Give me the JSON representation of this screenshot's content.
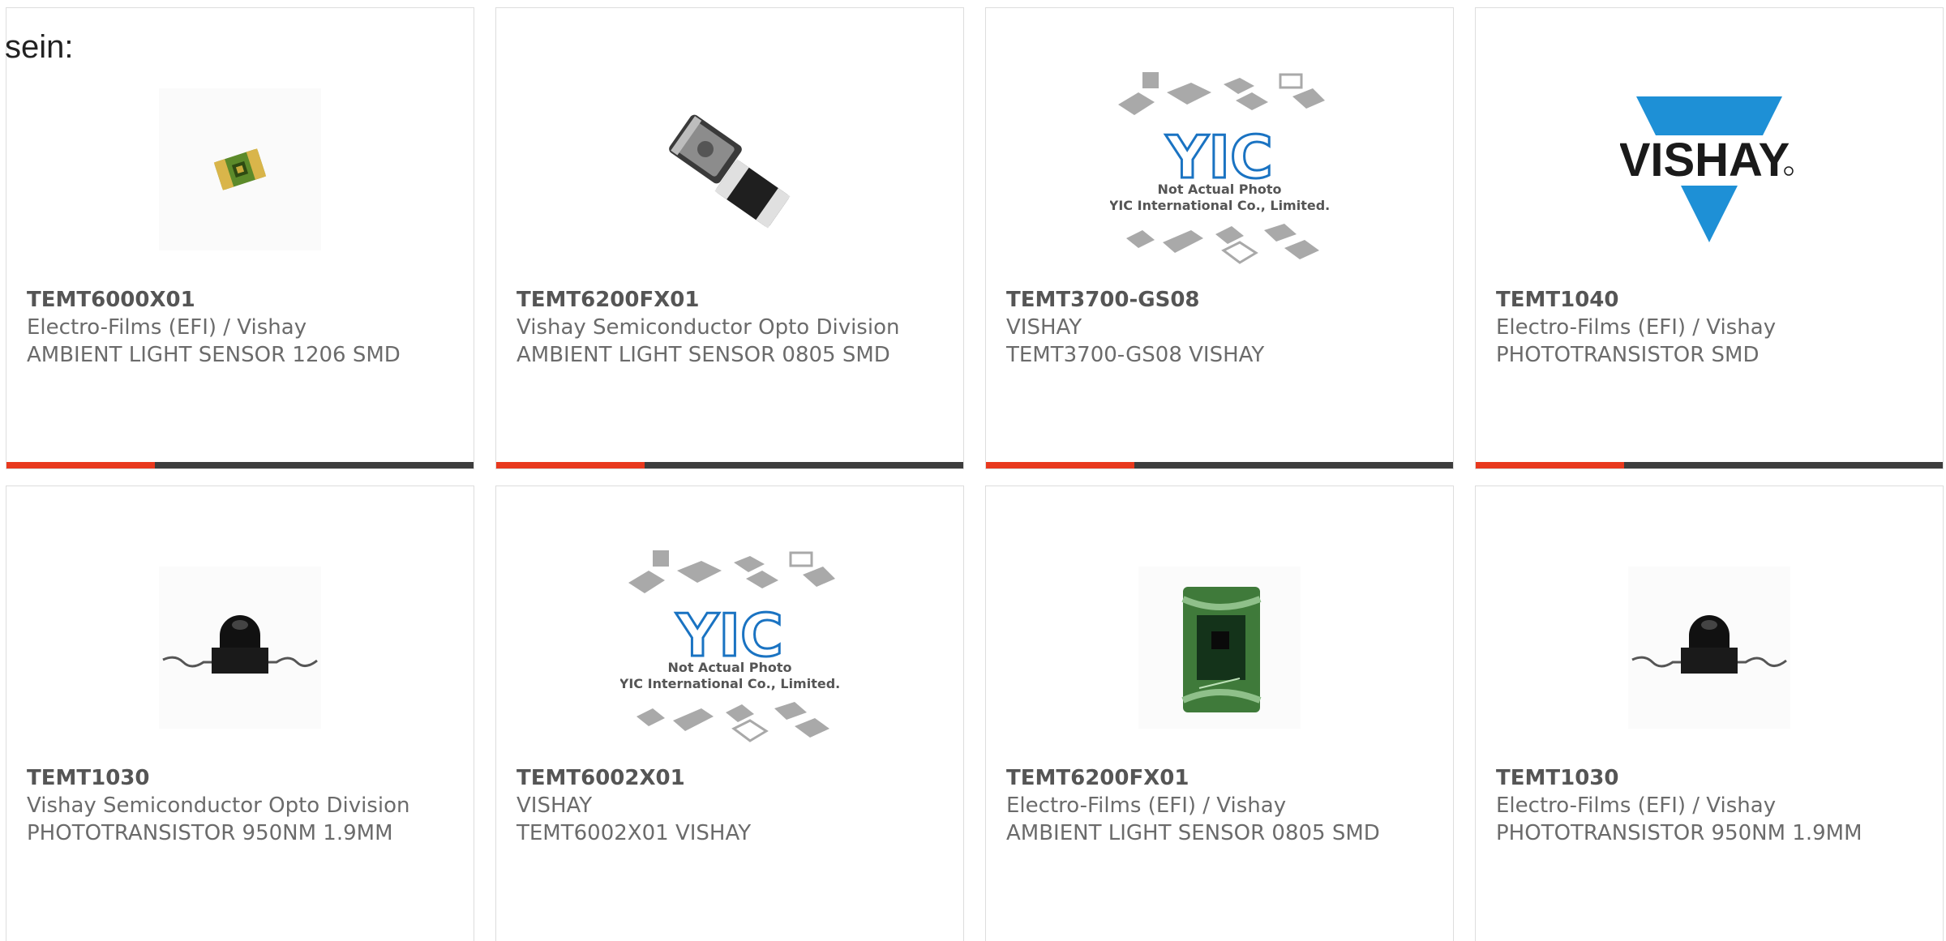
{
  "intro_text": "sein:",
  "colors": {
    "accent": "#e8391e",
    "bar_dark": "#3d3d3d",
    "vishay_blue": "#1e90d6",
    "yic_blue": "#1a73c2"
  },
  "cards": [
    {
      "part": "TEMT6000X01",
      "manufacturer": "Electro-Films (EFI) / Vishay",
      "description": "AMBIENT LIGHT SENSOR 1206 SMD",
      "image": "green-sensor-chip-icon"
    },
    {
      "part": "TEMT6200FX01",
      "manufacturer": "Vishay Semiconductor Opto Division",
      "description": "AMBIENT LIGHT SENSOR 0805 SMD",
      "image": "smd-components-photo"
    },
    {
      "part": "TEMT3700-GS08",
      "manufacturer": "VISHAY",
      "description": "TEMT3700-GS08 VISHAY",
      "image": "yic-placeholder",
      "placeholder_line1": "Not Actual Photo",
      "placeholder_line2": "YIC International Co., Limited.",
      "placeholder_logo": "YIC"
    },
    {
      "part": "TEMT1040",
      "manufacturer": "Electro-Films (EFI) / Vishay",
      "description": "PHOTOTRANSISTOR SMD",
      "image": "vishay-logo",
      "logo_text": "VISHAY"
    },
    {
      "part": "TEMT1030",
      "manufacturer": "Vishay Semiconductor Opto Division",
      "description": "PHOTOTRANSISTOR 950NM 1.9MM",
      "image": "phototransistor-photo"
    },
    {
      "part": "TEMT6002X01",
      "manufacturer": "VISHAY",
      "description": "TEMT6002X01 VISHAY",
      "image": "yic-placeholder",
      "placeholder_line1": "Not Actual Photo",
      "placeholder_line2": "YIC International Co., Limited.",
      "placeholder_logo": "YIC"
    },
    {
      "part": "TEMT6200FX01",
      "manufacturer": "Electro-Films (EFI) / Vishay",
      "description": "AMBIENT LIGHT SENSOR 0805 SMD",
      "image": "green-sensor-closeup-photo"
    },
    {
      "part": "TEMT1030",
      "manufacturer": "Electro-Films (EFI) / Vishay",
      "description": "PHOTOTRANSISTOR 950NM 1.9MM",
      "image": "phototransistor-photo"
    }
  ]
}
